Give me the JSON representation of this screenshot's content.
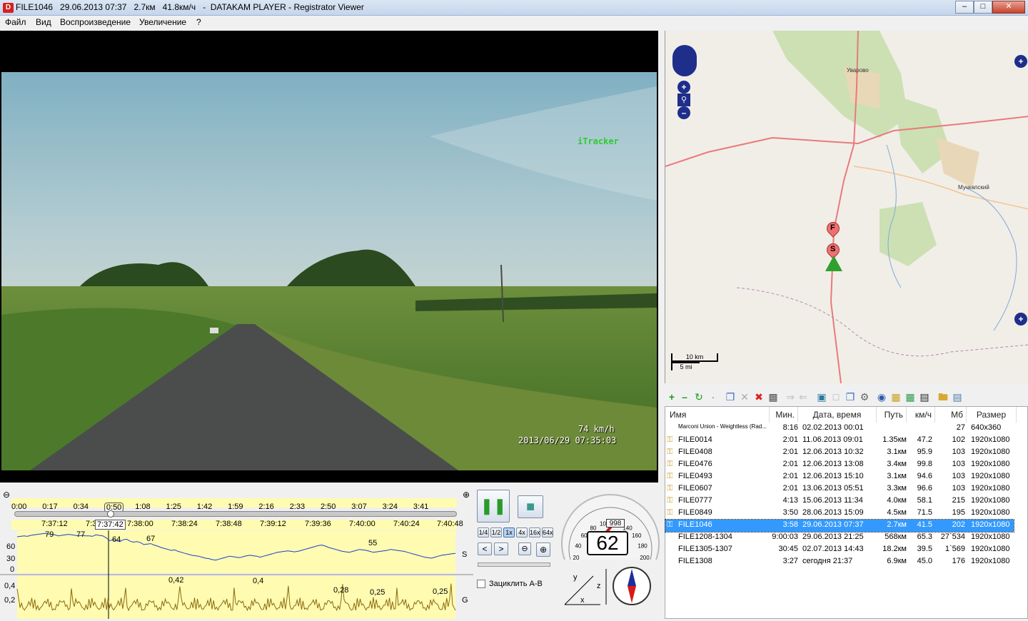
{
  "window": {
    "title": "FILE1046   29.06.2013 07:37   2.7км   41.8км/ч   -  DATAKAM PLAYER - Registrator Viewer",
    "icon": "app-logo-icon"
  },
  "menu": [
    "Файл",
    "Вид",
    "Воспроизведение",
    "Увеличение",
    "?"
  ],
  "video": {
    "osd_brand": "iTracker",
    "osd_speed": "74 km/h",
    "osd_datetime": "2013/06/29 07:35:03"
  },
  "map": {
    "town_1": "Уварово",
    "town_2": "Мучкапский",
    "scale_km": "10 km",
    "scale_mi": "5 mi",
    "start_marker": "S",
    "finish_marker": "F"
  },
  "toolbar": [
    "add-icon",
    "remove-icon",
    "refresh-icon",
    "dot-icon",
    "copy-icon",
    "cut-icon",
    "delete-icon",
    "undo-icon",
    "redo-icon",
    "export-icon",
    "select-icon",
    "windows-icon",
    "settings-icon",
    "globe-icon",
    "image-icon",
    "image-add-icon",
    "film-icon",
    "folder-icon",
    "document-icon"
  ],
  "filelist": {
    "headers": [
      "Имя",
      "Мин.",
      "Дата, время",
      "Путь",
      "км/ч",
      "Мб",
      "Размер"
    ],
    "rows": [
      {
        "name": "Marconi Union - Weightless (Rad...",
        "dur": "8:16",
        "date": "02.02.2013 00:01",
        "path": "",
        "speed": "",
        "mb": "27",
        "size": "640x360",
        "key": false,
        "sel": false,
        "small": true
      },
      {
        "name": "FILE0014",
        "dur": "2:01",
        "date": "11.06.2013 09:01",
        "path": "1.35км",
        "speed": "47.2",
        "mb": "102",
        "size": "1920x1080",
        "key": true,
        "sel": false
      },
      {
        "name": "FILE0408",
        "dur": "2:01",
        "date": "12.06.2013 10:32",
        "path": "3.1км",
        "speed": "95.9",
        "mb": "103",
        "size": "1920x1080",
        "key": true,
        "sel": false
      },
      {
        "name": "FILE0476",
        "dur": "2:01",
        "date": "12.06.2013 13:08",
        "path": "3.4км",
        "speed": "99.8",
        "mb": "103",
        "size": "1920x1080",
        "key": true,
        "sel": false
      },
      {
        "name": "FILE0493",
        "dur": "2:01",
        "date": "12.06.2013 15:10",
        "path": "3.1км",
        "speed": "94.6",
        "mb": "103",
        "size": "1920x1080",
        "key": true,
        "sel": false
      },
      {
        "name": "FILE0607",
        "dur": "2:01",
        "date": "13.06.2013 05:51",
        "path": "3.3км",
        "speed": "96.6",
        "mb": "103",
        "size": "1920x1080",
        "key": true,
        "sel": false
      },
      {
        "name": "FILE0777",
        "dur": "4:13",
        "date": "15.06.2013 11:34",
        "path": "4.0км",
        "speed": "58.1",
        "mb": "215",
        "size": "1920x1080",
        "key": true,
        "sel": false
      },
      {
        "name": "FILE0849",
        "dur": "3:50",
        "date": "28.06.2013 15:09",
        "path": "4.5км",
        "speed": "71.5",
        "mb": "195",
        "size": "1920x1080",
        "key": true,
        "sel": false
      },
      {
        "name": "FILE1046",
        "dur": "3:58",
        "date": "29.06.2013 07:37",
        "path": "2.7км",
        "speed": "41.5",
        "mb": "202",
        "size": "1920x1080",
        "key": true,
        "sel": true
      },
      {
        "name": "FILE1208-1304",
        "dur": "9:00:03",
        "date": "29.06.2013 21:25",
        "path": "568км",
        "speed": "65.3",
        "mb": "27`534",
        "size": "1920x1080",
        "key": false,
        "sel": false
      },
      {
        "name": "FILE1305-1307",
        "dur": "30:45",
        "date": "02.07.2013 14:43",
        "path": "18.2км",
        "speed": "39.5",
        "mb": "1`569",
        "size": "1920x1080",
        "key": false,
        "sel": false
      },
      {
        "name": "FILE1308",
        "dur": "3:27",
        "date": "сегодня 21:37",
        "path": "6.9км",
        "speed": "45.0",
        "mb": "176",
        "size": "1920x1080",
        "key": false,
        "sel": false
      }
    ]
  },
  "timeline": {
    "top_ticks": [
      "0:00",
      "0:17",
      "0:34",
      "0:50",
      "1:08",
      "1:25",
      "1:42",
      "1:59",
      "2:16",
      "2:33",
      "2:50",
      "3:07",
      "3:24",
      "3:41"
    ],
    "bottom_ticks": [
      "7:37:12",
      "7:3",
      "7:37:42",
      "7:38:00",
      "7:38:24",
      "7:38:48",
      "7:39:12",
      "7:39:36",
      "7:40:00",
      "7:40:24",
      "7:40:48"
    ],
    "current_marker": "0:50",
    "current_time": "7:37:42",
    "progress": 0.21
  },
  "graphs": {
    "speed": {
      "axis_label": "S",
      "y_ticks": [
        "60",
        "30",
        "0"
      ],
      "annotations": [
        "79",
        "77",
        "64",
        "67",
        "55"
      ],
      "values": [
        72,
        73,
        74,
        73,
        75,
        76,
        77,
        78,
        79,
        78,
        77,
        76,
        74,
        75,
        76,
        77,
        76,
        75,
        74,
        75,
        74,
        74,
        73,
        76,
        75,
        74,
        70,
        64,
        66,
        64,
        62,
        66,
        67,
        63,
        61,
        62,
        60,
        56,
        57,
        58,
        55,
        53,
        50,
        48,
        46,
        44,
        45,
        42,
        40,
        38,
        36,
        34,
        33,
        32,
        30,
        28,
        27,
        25,
        24,
        26,
        28,
        30,
        32,
        31,
        30,
        29,
        31,
        33,
        34,
        33,
        32,
        30,
        32,
        34,
        36,
        38,
        40,
        41,
        42,
        43,
        42,
        41,
        42,
        44,
        46,
        48,
        50,
        52,
        54,
        55,
        53,
        50,
        48,
        46,
        44,
        42,
        41,
        40,
        42,
        44,
        46,
        45,
        44,
        42,
        40,
        41,
        42,
        43,
        44,
        46,
        45,
        44,
        43,
        42,
        40,
        38,
        36,
        34,
        32,
        30,
        29,
        28,
        30,
        32,
        34,
        35,
        36,
        37,
        38
      ]
    },
    "g": {
      "axis_label": "G",
      "y_ticks": [
        "0,4",
        "0,2"
      ],
      "annotations": [
        "0,42",
        "0,4",
        "0,28",
        "0,25",
        "0,25"
      ]
    }
  },
  "controls": {
    "speeds": [
      "1/4",
      "1/2",
      "1x",
      "4x",
      "16x",
      "64x"
    ],
    "active_speed": "1x",
    "loop_label": "Зациклить A-B",
    "loop_checked": false
  },
  "gauge": {
    "speed_ticks": [
      "20",
      "40",
      "60",
      "80",
      "100",
      "120",
      "140",
      "160",
      "180",
      "200"
    ],
    "odometer": "998",
    "speed_value": "62",
    "needle_speed": 62,
    "axes_labels": [
      "x",
      "y",
      "z"
    ]
  }
}
